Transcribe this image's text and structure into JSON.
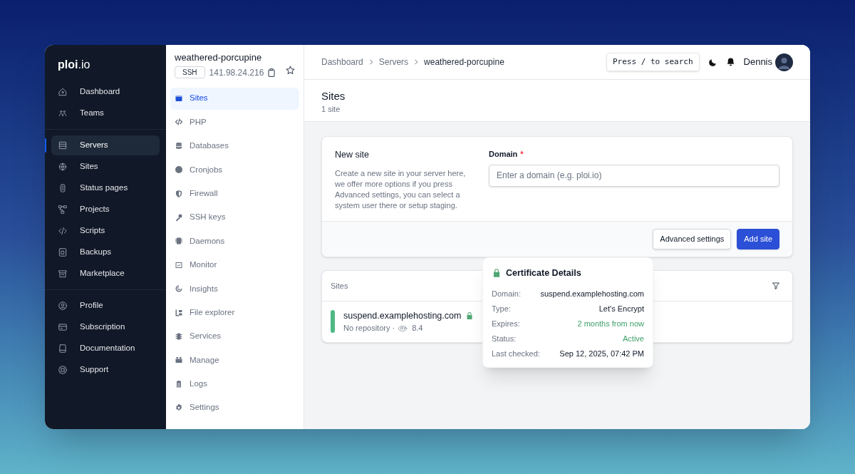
{
  "brand": {
    "bold": "ploi",
    "rest": ".io"
  },
  "main_nav": [
    [
      {
        "label": "Dashboard",
        "selected": false
      },
      {
        "label": "Teams",
        "selected": false
      }
    ],
    [
      {
        "label": "Servers",
        "selected": true
      },
      {
        "label": "Sites",
        "selected": false
      },
      {
        "label": "Status pages",
        "selected": false
      },
      {
        "label": "Projects",
        "selected": false
      },
      {
        "label": "Scripts",
        "selected": false
      },
      {
        "label": "Backups",
        "selected": false
      },
      {
        "label": "Marketplace",
        "selected": false
      }
    ],
    [
      {
        "label": "Profile",
        "selected": false
      },
      {
        "label": "Subscription",
        "selected": false
      },
      {
        "label": "Documentation",
        "selected": false
      },
      {
        "label": "Support",
        "selected": false
      }
    ]
  ],
  "server": {
    "name": "weathered-porcupine",
    "ssh": "SSH",
    "ip": "141.98.24.216",
    "starred": false
  },
  "server_nav": [
    {
      "label": "Sites",
      "selected": true
    },
    {
      "label": "PHP",
      "selected": false
    },
    {
      "label": "Databases",
      "selected": false
    },
    {
      "label": "Cronjobs",
      "selected": false
    },
    {
      "label": "Firewall",
      "selected": false
    },
    {
      "label": "SSH keys",
      "selected": false
    },
    {
      "label": "Daemons",
      "selected": false
    },
    {
      "label": "Monitor",
      "selected": false
    },
    {
      "label": "Insights",
      "selected": false
    },
    {
      "label": "File explorer",
      "selected": false
    },
    {
      "label": "Services",
      "selected": false
    },
    {
      "label": "Manage",
      "selected": false
    },
    {
      "label": "Logs",
      "selected": false
    },
    {
      "label": "Settings",
      "selected": false
    }
  ],
  "breadcrumbs": [
    "Dashboard",
    "Servers",
    "weathered-porcupine"
  ],
  "search_hint": "Press / to search",
  "user": "Dennis",
  "page": {
    "title": "Sites",
    "subtitle": "1 site"
  },
  "new_site": {
    "title": "New site",
    "description": "Create a new site in your server here, we offer more options if you press Advanced settings, you can select a system user there or setup staging.",
    "field_label": "Domain",
    "required": "*",
    "placeholder": "Enter a domain (e.g. ploi.io)",
    "buttons": [
      {
        "label": "Advanced settings",
        "kind": "secondary"
      },
      {
        "label": "Add site",
        "kind": "primary"
      }
    ]
  },
  "sites": {
    "heading": "Sites",
    "rows": [
      {
        "domain": "suspend.examplehosting.com",
        "color": "#4fb883",
        "secure": true,
        "repository": "No repository ·",
        "php": "8.4"
      }
    ]
  },
  "certificate": {
    "title": "Certificate Details",
    "rows": [
      {
        "label": "Domain:",
        "value": "suspend.examplehosting.com",
        "kind": "plain"
      },
      {
        "label": "Type:",
        "value": "Let's Encrypt",
        "kind": "plain"
      },
      {
        "label": "Expires:",
        "value": "2 months from now",
        "kind": "positive"
      },
      {
        "label": "Status:",
        "value": "Active",
        "kind": "positive"
      },
      {
        "label": "Last checked:",
        "value": "Sep 12, 2025, 07:42 PM",
        "kind": "plain"
      }
    ]
  }
}
